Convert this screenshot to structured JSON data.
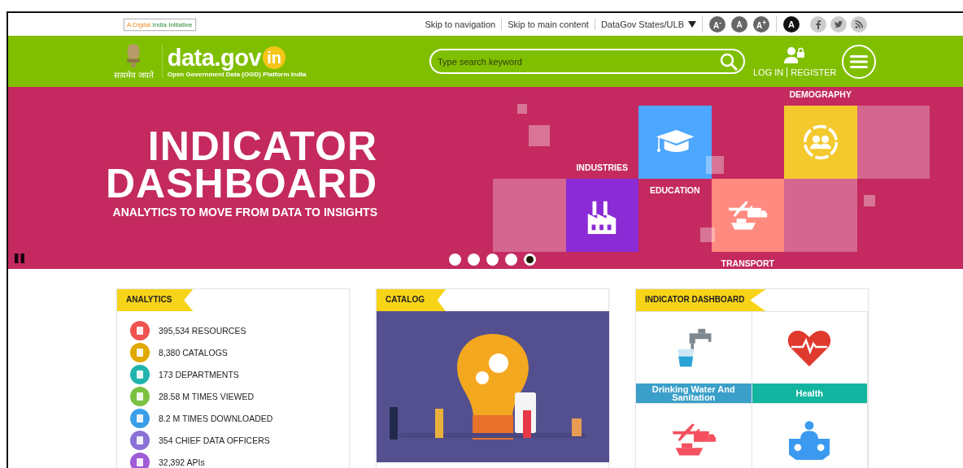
{
  "top_bar": {
    "initiative_badge": {
      "part1": "A Digital",
      "part2": "India Initiative"
    },
    "links": [
      "Skip to navigation",
      "Skip to main content"
    ],
    "states_dropdown": "DataGov States/ULB",
    "font_size_buttons": [
      {
        "label": "A$^{-}$"
      },
      {
        "label": "A"
      },
      {
        "label": "A$^{+}$"
      }
    ],
    "contrast_button": "A",
    "social": [
      {
        "kind": "facebook"
      },
      {
        "kind": "twitter"
      },
      {
        "kind": "rss"
      }
    ]
  },
  "header": {
    "emblem_motto": "सत्यमेव जयते",
    "logo": {
      "name": "data.gov",
      "suffix": "in",
      "tagline": "Open Government Data (OGD) Platform India"
    },
    "search": {
      "placeholder": "Type search keyword"
    },
    "auth_links": [
      "LOG IN",
      "REGISTER"
    ]
  },
  "banner": {
    "title": [
      "INDICATOR",
      "DASHBOARD"
    ],
    "subtitle": "ANALYTICS TO MOVE FROM DATA TO INSIGHTS",
    "tiles": [
      {
        "kind": "plain",
        "color": "#d4668f"
      },
      {
        "kind": "education",
        "color": "#4da6ff",
        "label": "EDUCATION"
      },
      {
        "kind": "demography",
        "color": "#f4c92e",
        "label": "DEMOGRAPHY"
      },
      {
        "kind": "plain",
        "color": "#d4668f"
      },
      {
        "kind": "industries",
        "color": "#8a2bd6",
        "label": "INDUSTRIES"
      },
      {
        "kind": "transport",
        "color": "#ff8a80",
        "label": "TRANSPORT"
      },
      {
        "kind": "plain",
        "color": "#d4668f"
      }
    ],
    "slides": [
      {
        "selected": false
      },
      {
        "selected": false
      },
      {
        "selected": false
      },
      {
        "selected": false
      },
      {
        "selected": true
      }
    ]
  },
  "cards": [
    {
      "kind": "analytics",
      "title": "ANALYTICS",
      "stats": [
        {
          "text": "395,534 RESOURCES",
          "color": "#ef5350"
        },
        {
          "text": "8,380 CATALOGS",
          "color": "#e0a800"
        },
        {
          "text": "173 DEPARTMENTS",
          "color": "#1fb5ad"
        },
        {
          "text": "28.58 M TIMES VIEWED",
          "color": "#7cc242"
        },
        {
          "text": "8.2 M TIMES DOWNLOADED",
          "color": "#3a9ee8"
        },
        {
          "text": "354 CHIEF DATA OFFICERS",
          "color": "#8a72d6"
        },
        {
          "text": "32,392 APIs",
          "color": "#a05cd6"
        }
      ]
    },
    {
      "kind": "catalog",
      "title": "CATALOG"
    },
    {
      "kind": "indicators",
      "title": "INDICATOR DASHBOARD",
      "tiles": [
        {
          "kind": "water",
          "label": "Drinking Water And Sanitation",
          "color": "#3a9fc9"
        },
        {
          "kind": "health",
          "label": "Health",
          "color": "#13b5a0"
        },
        {
          "kind": "transport"
        },
        {
          "kind": "meeting"
        }
      ]
    }
  ]
}
